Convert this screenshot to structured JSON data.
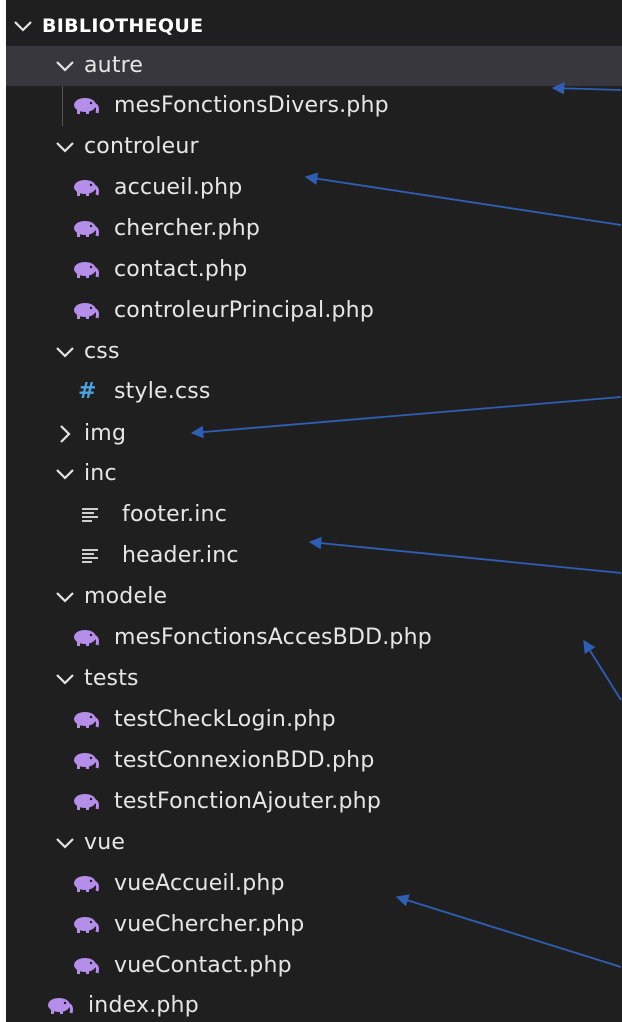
{
  "explorer": {
    "section_title": "BIBLIOTHEQUE",
    "items": [
      {
        "label": "autre",
        "type": "folder",
        "expanded": true,
        "selected": true
      },
      {
        "label": "mesFonctionsDivers.php",
        "type": "file",
        "icon": "php-elephant-icon"
      },
      {
        "label": "controleur",
        "type": "folder",
        "expanded": true
      },
      {
        "label": "accueil.php",
        "type": "file",
        "icon": "php-elephant-icon"
      },
      {
        "label": "chercher.php",
        "type": "file",
        "icon": "php-elephant-icon"
      },
      {
        "label": "contact.php",
        "type": "file",
        "icon": "php-elephant-icon"
      },
      {
        "label": "controleurPrincipal.php",
        "type": "file",
        "icon": "php-elephant-icon"
      },
      {
        "label": "css",
        "type": "folder",
        "expanded": true
      },
      {
        "label": "style.css",
        "type": "file",
        "icon": "css-hash-icon"
      },
      {
        "label": "img",
        "type": "folder",
        "expanded": false
      },
      {
        "label": "inc",
        "type": "folder",
        "expanded": true
      },
      {
        "label": "footer.inc",
        "type": "file",
        "icon": "text-lines-icon"
      },
      {
        "label": "header.inc",
        "type": "file",
        "icon": "text-lines-icon"
      },
      {
        "label": "modele",
        "type": "folder",
        "expanded": true
      },
      {
        "label": "mesFonctionsAccesBDD.php",
        "type": "file",
        "icon": "php-elephant-icon"
      },
      {
        "label": "tests",
        "type": "folder",
        "expanded": true
      },
      {
        "label": "testCheckLogin.php",
        "type": "file",
        "icon": "php-elephant-icon"
      },
      {
        "label": "testConnexionBDD.php",
        "type": "file",
        "icon": "php-elephant-icon"
      },
      {
        "label": "testFonctionAjouter.php",
        "type": "file",
        "icon": "php-elephant-icon"
      },
      {
        "label": "vue",
        "type": "folder",
        "expanded": true
      },
      {
        "label": "vueAccueil.php",
        "type": "file",
        "icon": "php-elephant-icon"
      },
      {
        "label": "vueChercher.php",
        "type": "file",
        "icon": "php-elephant-icon"
      },
      {
        "label": "vueContact.php",
        "type": "file",
        "icon": "php-elephant-icon"
      },
      {
        "label": "index.php",
        "type": "file",
        "icon": "php-elephant-icon"
      }
    ]
  },
  "colors": {
    "background": "#1f1f1f",
    "selected_row": "#37373d",
    "text": "#e6e6e6",
    "php_icon": "#b48ee8",
    "css_icon": "#4aa3df",
    "annotation_arrow": "#2f5fb5"
  }
}
